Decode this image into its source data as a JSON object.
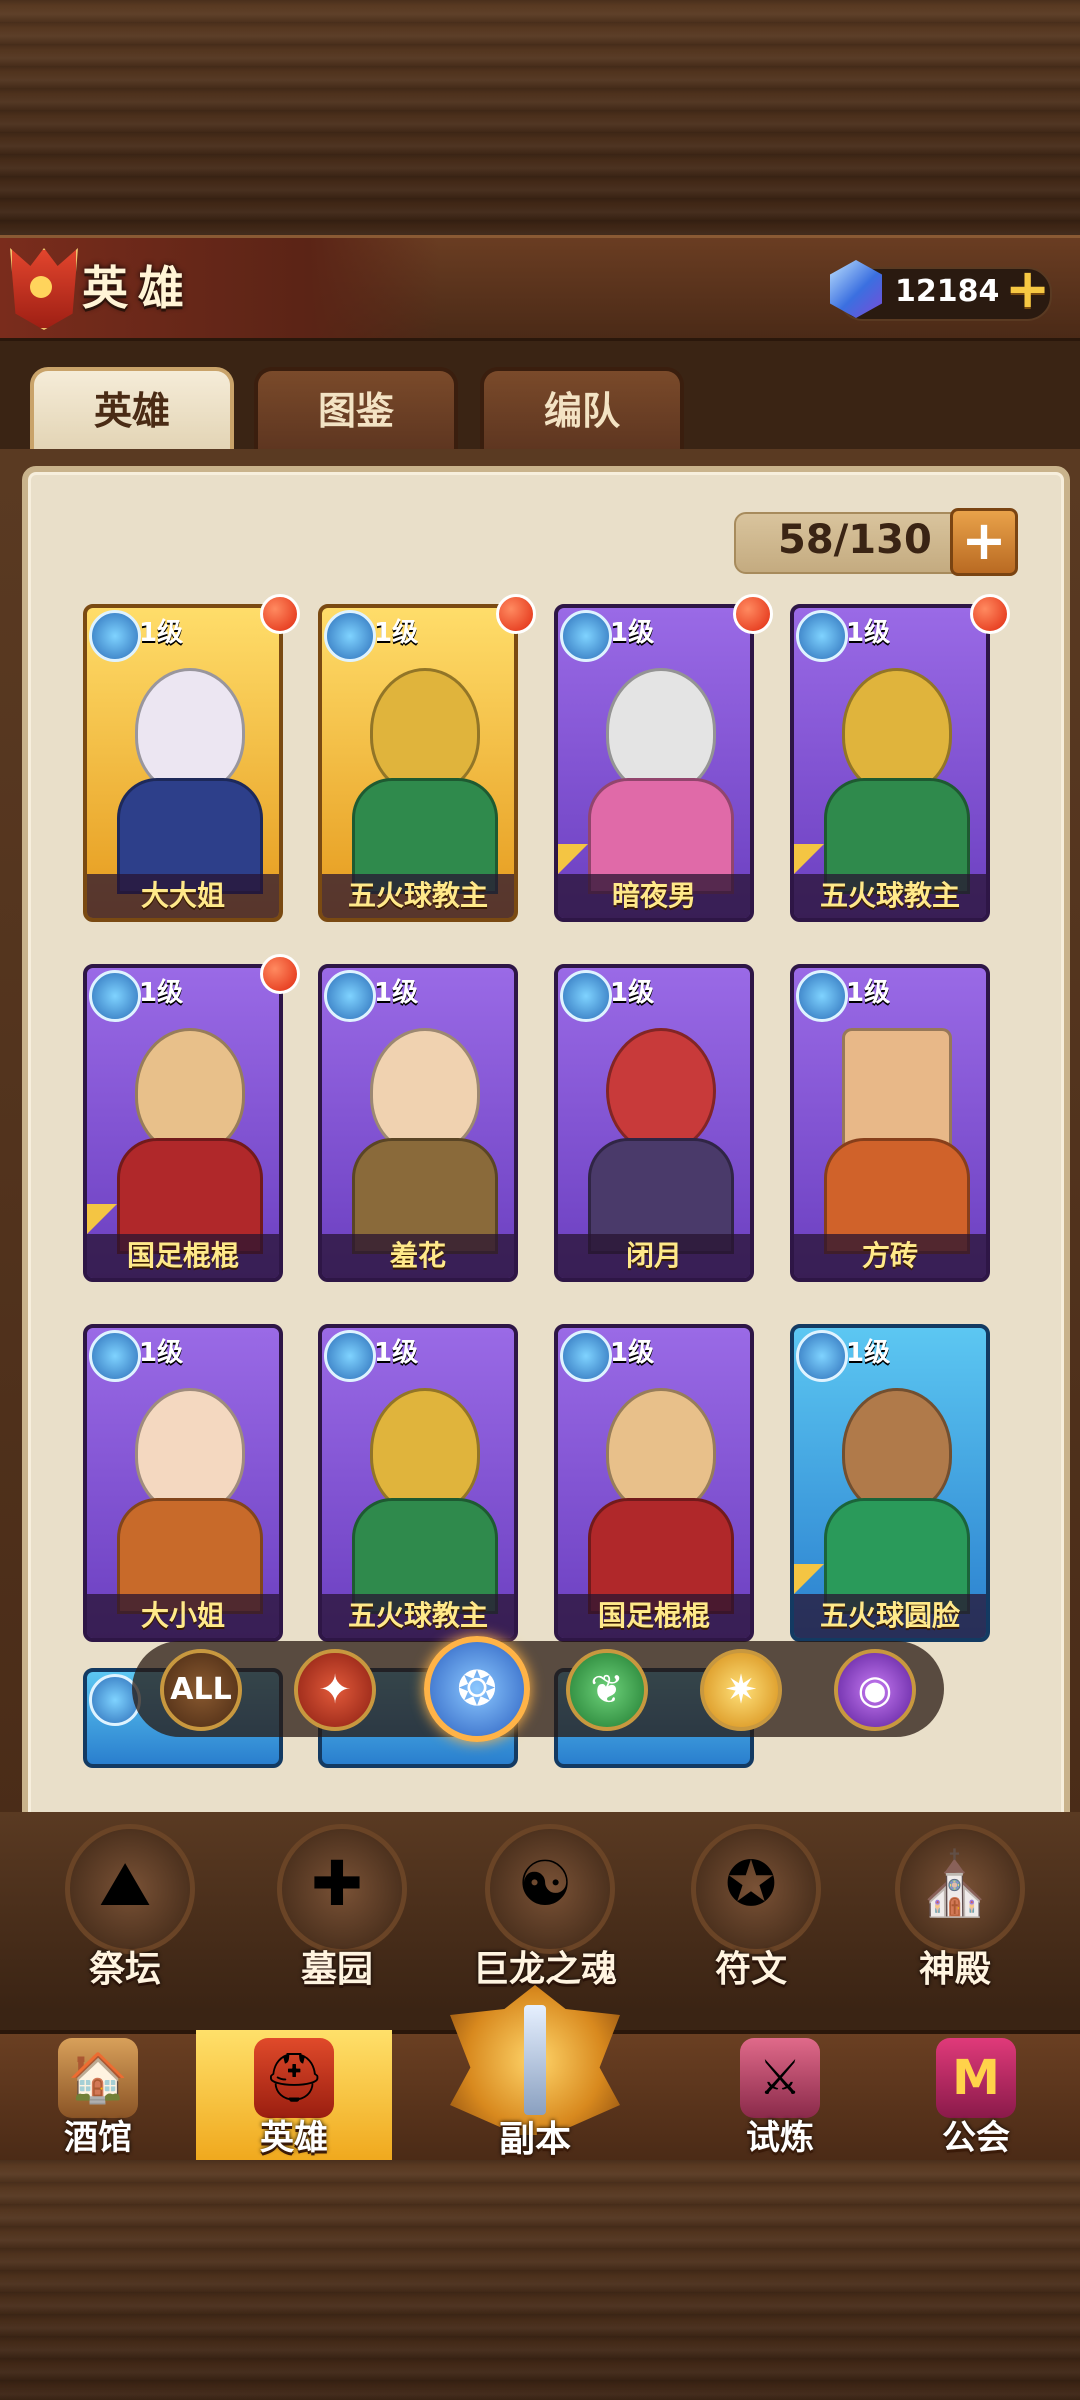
{
  "header": {
    "title": "英雄",
    "gems": "12184",
    "gem_plus": "+"
  },
  "tabs": [
    {
      "label": "英雄",
      "active": true
    },
    {
      "label": "图鉴",
      "active": false
    },
    {
      "label": "编队",
      "active": false
    }
  ],
  "capacity": {
    "text": "58/130",
    "plus": "+"
  },
  "level_label": "1级",
  "heroes": [
    {
      "name": "大大姐",
      "rarity": "gold",
      "badge": true
    },
    {
      "name": "五火球教主",
      "rarity": "gold",
      "badge": true
    },
    {
      "name": "暗夜男",
      "rarity": "purple",
      "badge": true
    },
    {
      "name": "五火球教主",
      "rarity": "purple",
      "badge": true
    },
    {
      "name": "国足棍棍",
      "rarity": "purple",
      "badge": true
    },
    {
      "name": "羞花",
      "rarity": "purple",
      "badge": false
    },
    {
      "name": "闭月",
      "rarity": "purple",
      "badge": false
    },
    {
      "name": "方砖",
      "rarity": "purple",
      "badge": false
    },
    {
      "name": "大小姐",
      "rarity": "purple",
      "badge": false
    },
    {
      "name": "五火球教主",
      "rarity": "purple",
      "badge": false
    },
    {
      "name": "国足棍棍",
      "rarity": "purple",
      "badge": false
    },
    {
      "name": "五火球圆脸",
      "rarity": "blue",
      "badge": false
    }
  ],
  "filters": {
    "all": "ALL",
    "selected": "water",
    "icons": [
      "all-icon",
      "fire-faction-icon",
      "water-faction-icon",
      "nature-faction-icon",
      "light-faction-icon",
      "dark-faction-icon"
    ]
  },
  "buildings": [
    {
      "label": "祭坛",
      "icon": "altar-icon"
    },
    {
      "label": "墓园",
      "icon": "graveyard-icon"
    },
    {
      "label": "巨龙之魂",
      "icon": "dragon-soul-icon"
    },
    {
      "label": "符文",
      "icon": "rune-icon"
    },
    {
      "label": "神殿",
      "icon": "temple-icon"
    }
  ],
  "nav": {
    "tavern": "酒馆",
    "heroes": "英雄",
    "dungeon": "副本",
    "trial": "试炼",
    "guild": "公会",
    "active": "heroes"
  },
  "colors": {
    "gold_card": "#e59a1d",
    "purple_card": "#6b3fc0",
    "blue_card": "#2a7fce",
    "accent": "#f6c843"
  }
}
